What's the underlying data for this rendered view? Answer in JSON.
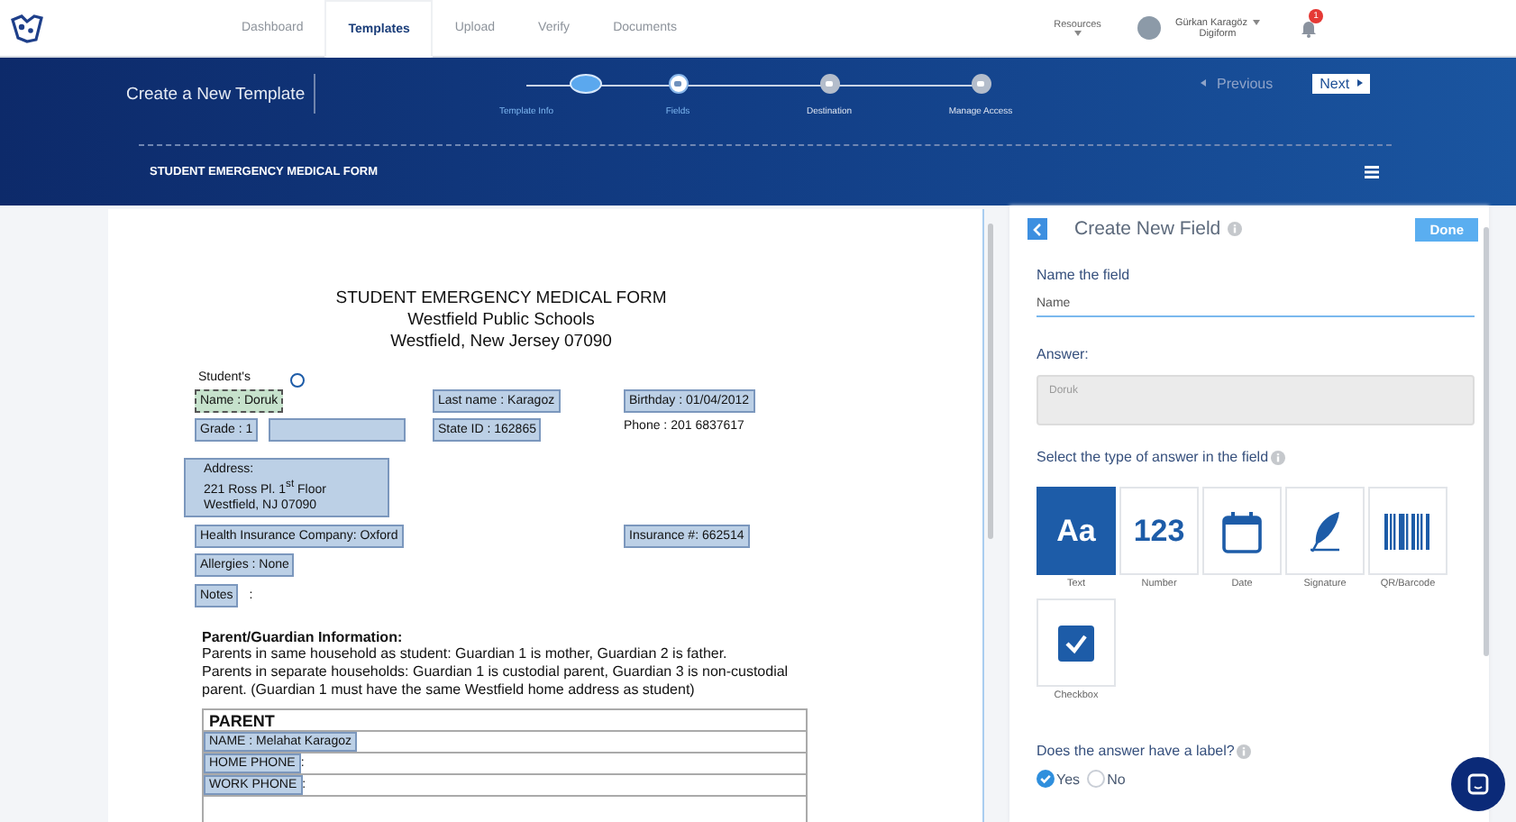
{
  "nav": {
    "items": [
      {
        "label": "Dashboard",
        "selected": false
      },
      {
        "label": "Templates",
        "selected": true
      },
      {
        "label": "Upload",
        "selected": false
      },
      {
        "label": "Verify",
        "selected": false
      },
      {
        "label": "Documents",
        "selected": false
      }
    ],
    "resources": "Resources",
    "user_name": "Gürkan Karagöz",
    "user_org": "Digiform",
    "notifications": "1"
  },
  "header": {
    "title": "Create a New Template",
    "steps": [
      {
        "label": "Template Info",
        "done": true,
        "current": false
      },
      {
        "label": "Fields",
        "done": false,
        "current": true
      },
      {
        "label": "Destination",
        "done": false,
        "current": false
      },
      {
        "label": "Manage Access",
        "done": false,
        "current": false
      }
    ],
    "previous": "Previous",
    "next": "Next",
    "form_title": "STUDENT EMERGENCY MEDICAL FORM"
  },
  "document": {
    "heading": [
      "STUDENT EMERGENCY MEDICAL FORM",
      "Westfield Public Schools",
      "Westfield, New Jersey 07090"
    ],
    "students_label": "Student's",
    "rows": [
      {
        "cells": [
          [
            {
              "kind": "field",
              "text": "Name  : Doruk",
              "selected": true
            }
          ],
          [
            {
              "kind": "field",
              "text": "Last name : Karagoz",
              "selected": false
            }
          ],
          [
            {
              "kind": "field",
              "text": "Birthday : 01/04/2012",
              "selected": false
            }
          ]
        ]
      },
      {
        "cells": [
          [
            {
              "kind": "field",
              "text": "Grade : 1",
              "selected": false
            },
            {
              "kind": "empty-field",
              "selected": false
            }
          ],
          [
            {
              "kind": "field",
              "text": "State ID : 162865",
              "selected": false
            }
          ],
          [
            {
              "kind": "text",
              "text": "Phone : 201 6837617"
            }
          ]
        ]
      },
      {
        "cells": [
          [
            {
              "kind": "block-field",
              "text": "Address:\n221 Ross Pl. 1$^{st}$ Floor\nWestfield, NJ 07090",
              "selected": false
            }
          ]
        ]
      },
      {
        "cells": [
          [
            {
              "kind": "field",
              "text": "Health Insurance Company: Oxford",
              "selected": false
            }
          ],
          [],
          [
            {
              "kind": "field",
              "text": "Insurance #: 662514",
              "selected": false
            }
          ]
        ]
      },
      {
        "cells": [
          [
            {
              "kind": "field",
              "text": "Allergies : None",
              "selected": false
            }
          ]
        ]
      },
      {
        "cells": [
          [
            {
              "kind": "field",
              "text": "Notes",
              "selected": false
            },
            {
              "kind": "text",
              "text": ":"
            }
          ]
        ]
      }
    ],
    "guardian_heading": "Parent/Guardian Information:",
    "guardian_paragraphs": [
      "Parents in same household as student: Guardian 1 is mother, Guardian 2 is father.",
      "Parents in separate households: Guardian 1 is custodial parent, Guardian 3 is non-custodial parent. (Guardian 1 must have the same Westfield home address as student)"
    ],
    "table_title": "PARENT",
    "table_rows": [
      {
        "field": "NAME : Melahat Karagoz",
        "rest": ""
      },
      {
        "field": "HOME PHONE",
        "rest": ":"
      },
      {
        "field": "WORK PHONE",
        "rest": ":"
      }
    ]
  },
  "panel": {
    "title": "Create New Field",
    "done": "Done",
    "name_label": "Name the field",
    "name_value": "Name",
    "answer_label": "Answer:",
    "answer_placeholder": "Doruk",
    "type_label": "Select the type of answer in the field",
    "types": [
      {
        "kind": "text",
        "glyph": "Aa",
        "label": "Text",
        "selected": true
      },
      {
        "kind": "number",
        "glyph": "123",
        "label": "Number",
        "selected": false
      },
      {
        "kind": "date",
        "label": "Date",
        "selected": false
      },
      {
        "kind": "signature",
        "label": "Signature",
        "selected": false
      },
      {
        "kind": "barcode",
        "label": "QR/Barcode",
        "selected": false
      },
      {
        "kind": "checkbox",
        "label": "Checkbox",
        "selected": false
      }
    ],
    "label_question": "Does the answer have a label?",
    "options": [
      {
        "label": "Yes",
        "selected": true
      },
      {
        "label": "No",
        "selected": false
      }
    ]
  }
}
